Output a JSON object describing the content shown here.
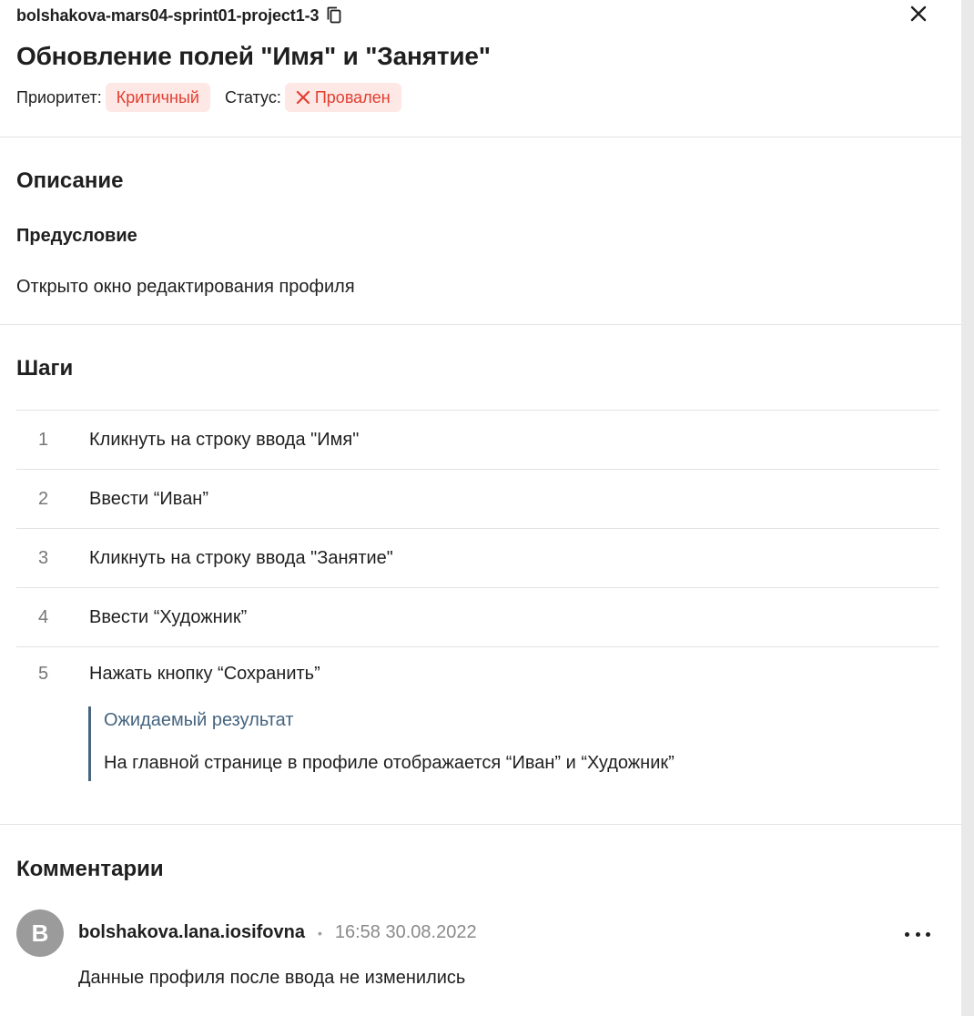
{
  "header": {
    "test_id": "bolshakova-mars04-sprint01-project1-3",
    "title": "Обновление полей \"Имя\" и \"Занятие\"",
    "priority_label": "Приоритет:",
    "priority_value": "Критичный",
    "status_label": "Статус:",
    "status_value": "Провален"
  },
  "description": {
    "title": "Описание",
    "precondition_title": "Предусловие",
    "precondition_text": "Открыто окно редактирования профиля"
  },
  "steps": {
    "title": "Шаги",
    "items": [
      {
        "num": "1",
        "text": "Кликнуть на строку ввода \"Имя\""
      },
      {
        "num": "2",
        "text": "Ввести “Иван”"
      },
      {
        "num": "3",
        "text": "Кликнуть на строку ввода \"Занятие\""
      },
      {
        "num": "4",
        "text": "Ввести “Художник”"
      },
      {
        "num": "5",
        "text": "Нажать кнопку “Сохранить”"
      }
    ],
    "expected_label": "Ожидаемый результат",
    "expected_text": "На главной странице в профиле отображается “Иван” и “Художник”"
  },
  "comments": {
    "title": "Комментарии",
    "items": [
      {
        "avatar_letter": "B",
        "author": "bolshakova.lana.iosifovna",
        "separator": "•",
        "time": "16:58 30.08.2022",
        "text": "Данные профиля после ввода не изменились"
      }
    ]
  },
  "colors": {
    "danger": "#e23f31",
    "danger_bg": "#fde8e6",
    "expected_accent": "#45647f",
    "avatar_bg": "#9b9b9b"
  },
  "icons": {
    "copy": "copy-icon",
    "close": "close-icon",
    "status": "cross-icon",
    "more": "more-horizontal-icon"
  }
}
